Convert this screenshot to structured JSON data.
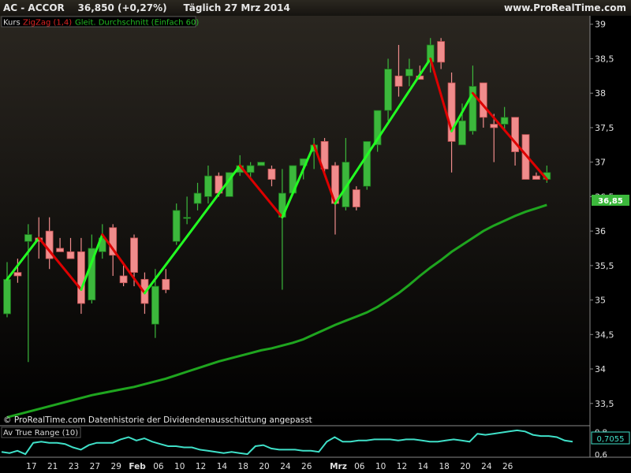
{
  "header": {
    "instrument": "AC - ACCOR",
    "price_change": "36,850 (+0,27%)",
    "period_date": "Täglich  27 Mrz 2014",
    "site": "www.ProRealTime.com"
  },
  "legend": {
    "kurs": "Kurs",
    "zigzag": "ZigZag (1,4)",
    "ma": "Gleit. Durchschnitt (Einfach 60)"
  },
  "footer": {
    "copyright": "© ProRealTime.com  Datenhistorie der Dividendenausschüttung angepasst"
  },
  "lower_panel": {
    "title": "Av True Range (10)",
    "last_value": "0,7055"
  },
  "colors": {
    "up_candle": "#3cb83c",
    "up_candle_border": "#1a6e1a",
    "down_candle": "#f08c8c",
    "down_candle_border": "#c05050",
    "zigzag_up": "#22ff22",
    "zigzag_down": "#dd0000",
    "ma": "#1fa51f",
    "atr": "#3fe0c8",
    "axis_text": "#e0e0e0",
    "last_price_label": "#3cb83c"
  },
  "chart_data": [
    {
      "type": "candlestick",
      "title": "AC - ACCOR",
      "ylim": [
        33.2,
        39.1
      ],
      "y_ticks": [
        "33,5",
        "34",
        "34,5",
        "35",
        "35,5",
        "36",
        "36,5",
        "37",
        "37,5",
        "38",
        "38,5",
        "39"
      ],
      "x_ticks": [
        "17",
        "21",
        "23",
        "27",
        "29",
        "Feb",
        "06",
        "10",
        "12",
        "14",
        "18",
        "20",
        "24",
        "26",
        "Mrz",
        "06",
        "10",
        "12",
        "14",
        "18",
        "20",
        "24",
        "26"
      ],
      "ohlc": [
        [
          34.8,
          35.55,
          34.75,
          35.3
        ],
        [
          35.4,
          35.6,
          35.25,
          35.35
        ],
        [
          35.85,
          36.1,
          34.1,
          35.95
        ],
        [
          35.9,
          36.2,
          35.6,
          35.85
        ],
        [
          36.0,
          36.2,
          35.45,
          35.6
        ],
        [
          35.75,
          35.9,
          35.7,
          35.7
        ],
        [
          35.7,
          35.9,
          35.6,
          35.6
        ],
        [
          35.7,
          35.9,
          34.8,
          34.95
        ],
        [
          35.0,
          35.95,
          34.95,
          35.75
        ],
        [
          35.7,
          36.1,
          35.6,
          35.9
        ],
        [
          36.05,
          36.1,
          35.35,
          35.65
        ],
        [
          35.35,
          35.5,
          35.2,
          35.25
        ],
        [
          35.9,
          35.95,
          35.2,
          35.4
        ],
        [
          35.3,
          35.4,
          34.8,
          34.95
        ],
        [
          34.65,
          35.45,
          34.45,
          35.2
        ],
        [
          35.3,
          35.45,
          35.1,
          35.15
        ],
        [
          35.85,
          36.4,
          35.8,
          36.3
        ],
        [
          36.2,
          36.5,
          36.1,
          36.2
        ],
        [
          36.4,
          36.7,
          36.3,
          36.55
        ],
        [
          36.5,
          36.95,
          36.4,
          36.8
        ],
        [
          36.8,
          36.85,
          36.5,
          36.55
        ],
        [
          36.5,
          36.85,
          36.5,
          36.85
        ],
        [
          36.85,
          37.1,
          36.8,
          36.95
        ],
        [
          36.85,
          37.0,
          36.75,
          36.95
        ],
        [
          36.95,
          37.0,
          36.95,
          37.0
        ],
        [
          36.9,
          36.95,
          36.65,
          36.75
        ],
        [
          36.2,
          36.9,
          35.15,
          36.55
        ],
        [
          36.55,
          36.95,
          36.55,
          36.95
        ],
        [
          36.95,
          37.05,
          36.75,
          37.05
        ],
        [
          37.15,
          37.35,
          36.9,
          37.25
        ],
        [
          37.3,
          37.35,
          36.8,
          36.9
        ],
        [
          36.95,
          37.0,
          35.95,
          36.4
        ],
        [
          36.35,
          37.35,
          36.3,
          37.0
        ],
        [
          36.6,
          36.65,
          36.3,
          36.35
        ],
        [
          36.65,
          37.3,
          36.6,
          37.3
        ],
        [
          37.25,
          37.75,
          37.15,
          37.75
        ],
        [
          37.75,
          38.5,
          37.6,
          38.35
        ],
        [
          38.25,
          38.7,
          37.95,
          38.1
        ],
        [
          38.25,
          38.5,
          38.1,
          38.35
        ],
        [
          38.25,
          38.4,
          38.2,
          38.2
        ],
        [
          38.45,
          38.8,
          38.3,
          38.7
        ],
        [
          38.75,
          38.8,
          38.35,
          38.45
        ],
        [
          38.15,
          38.3,
          36.85,
          37.3
        ],
        [
          37.25,
          37.85,
          37.25,
          37.6
        ],
        [
          37.45,
          38.4,
          37.4,
          38.1
        ],
        [
          38.15,
          38.15,
          37.5,
          37.65
        ],
        [
          37.55,
          37.7,
          37.0,
          37.5
        ],
        [
          37.55,
          37.8,
          37.45,
          37.65
        ],
        [
          37.65,
          37.65,
          36.95,
          37.15
        ],
        [
          37.4,
          37.4,
          36.75,
          36.75
        ],
        [
          36.8,
          36.85,
          36.75,
          36.75
        ],
        [
          36.75,
          36.95,
          36.7,
          36.85
        ]
      ],
      "last_price": 36.85,
      "moving_average": {
        "name": "Gleit. Durchschnitt (Einfach 60)",
        "values": [
          33.3,
          33.34,
          33.38,
          33.42,
          33.46,
          33.5,
          33.54,
          33.58,
          33.62,
          33.65,
          33.68,
          33.71,
          33.74,
          33.78,
          33.82,
          33.86,
          33.91,
          33.96,
          34.01,
          34.06,
          34.11,
          34.15,
          34.19,
          34.23,
          34.27,
          34.3,
          34.34,
          34.38,
          34.43,
          34.5,
          34.57,
          34.64,
          34.7,
          34.76,
          34.82,
          34.9,
          35.0,
          35.1,
          35.22,
          35.35,
          35.47,
          35.58,
          35.7,
          35.8,
          35.9,
          36.0,
          36.08,
          36.15,
          36.22,
          36.28,
          36.33,
          36.38
        ]
      },
      "zigzag": {
        "name": "ZigZag (1,4)",
        "points": [
          [
            0,
            35.3
          ],
          [
            3,
            35.9
          ],
          [
            7,
            35.15
          ],
          [
            9,
            35.95
          ],
          [
            13,
            35.1
          ],
          [
            22,
            36.95
          ],
          [
            26,
            36.2
          ],
          [
            29,
            37.25
          ],
          [
            31,
            36.4
          ],
          [
            40,
            38.5
          ],
          [
            42,
            37.45
          ],
          [
            44,
            38.0
          ],
          [
            51,
            36.75
          ]
        ]
      }
    },
    {
      "type": "line",
      "title": "Av True Range (10)",
      "ylim": [
        0.58,
        0.83
      ],
      "y_ticks": [
        "0,6",
        "0,8"
      ],
      "values": [
        0.62,
        0.61,
        0.63,
        0.6,
        0.7,
        0.71,
        0.7,
        0.7,
        0.69,
        0.66,
        0.64,
        0.68,
        0.7,
        0.7,
        0.7,
        0.73,
        0.75,
        0.72,
        0.74,
        0.71,
        0.69,
        0.67,
        0.67,
        0.66,
        0.66,
        0.64,
        0.63,
        0.62,
        0.61,
        0.62,
        0.61,
        0.6,
        0.67,
        0.68,
        0.65,
        0.64,
        0.64,
        0.64,
        0.63,
        0.63,
        0.62,
        0.71,
        0.75,
        0.71,
        0.71,
        0.72,
        0.72,
        0.73,
        0.73,
        0.73,
        0.72,
        0.73,
        0.73,
        0.72,
        0.71,
        0.71,
        0.72,
        0.73,
        0.72,
        0.71,
        0.78,
        0.77,
        0.78,
        0.79,
        0.8,
        0.81,
        0.8,
        0.77,
        0.76,
        0.76,
        0.75,
        0.72,
        0.71
      ]
    }
  ]
}
